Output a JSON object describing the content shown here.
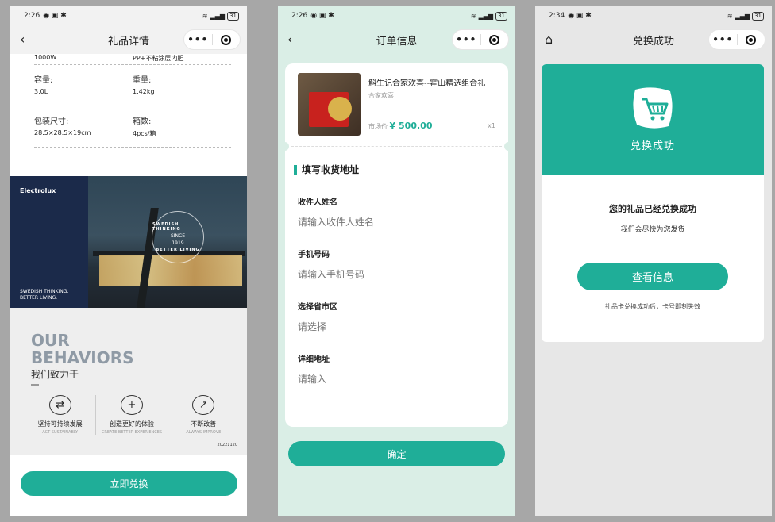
{
  "screens": {
    "detail": {
      "status": {
        "time": "2:26",
        "battery": "31"
      },
      "title": "礼品详情",
      "spec_top": {
        "left": "1000W",
        "right": "PP+不粘涂层内胆"
      },
      "specs": [
        {
          "left_label": "容量:",
          "left_value": "3.0L",
          "right_label": "重量:",
          "right_value": "1.42kg"
        },
        {
          "left_label": "包装尺寸:",
          "left_value": "28.5×28.5×19cm",
          "right_label": "箱数:",
          "right_value": "4pcs/箱"
        }
      ],
      "banner": {
        "brand": "Electrolux",
        "tagline_1": "SWEDISH THINKING.",
        "tagline_2": "BETTER LIVING.",
        "stamp_top": "SWEDISH THINKING",
        "stamp_since": "SINCE",
        "stamp_year": "1919",
        "stamp_bottom": "BETTER LIVING"
      },
      "behaviors": {
        "title_1": "OUR",
        "title_2": "BEHAVIORS",
        "subtitle": "我们致力于",
        "items": [
          {
            "icon": "cycle-icon",
            "glyph": "⇄",
            "label": "坚持可持续发展",
            "en": "ACT SUSTAINABLY"
          },
          {
            "icon": "plus-icon",
            "glyph": "+",
            "label": "创造更好的体验",
            "en": "CREATE BETTER EXPERIENCES"
          },
          {
            "icon": "trend-up-icon",
            "glyph": "↗",
            "label": "不断改善",
            "en": "ALWAYS IMPROVE"
          }
        ],
        "code": "20221120"
      },
      "button": "立即兑换"
    },
    "order": {
      "status": {
        "time": "2:26",
        "battery": "31"
      },
      "title": "订单信息",
      "product": {
        "name": "斛生记合家欢喜--霍山精选组合礼",
        "shop": "合家欢喜",
        "price_label": "市场价",
        "price": "¥ 500.00",
        "qty": "x1"
      },
      "section_title": "填写收货地址",
      "fields": [
        {
          "label": "收件人姓名",
          "placeholder": "请输入收件人姓名"
        },
        {
          "label": "手机号码",
          "placeholder": "请输入手机号码"
        },
        {
          "label": "选择省市区",
          "placeholder": "请选择"
        },
        {
          "label": "详细地址",
          "placeholder": "请输入"
        }
      ],
      "button": "确定"
    },
    "success": {
      "status": {
        "time": "2:34",
        "battery": "31"
      },
      "title": "兑换成功",
      "banner_title": "兑换成功",
      "message": "您的礼品已经兑换成功",
      "sub": "我们会尽快为您发货",
      "button": "查看信息",
      "note": "礼品卡兑换成功后，卡号即刻失效"
    }
  },
  "colors": {
    "accent": "#1fae98",
    "order_bg": "#daeee6",
    "page_bg": "#a7a7a7"
  }
}
